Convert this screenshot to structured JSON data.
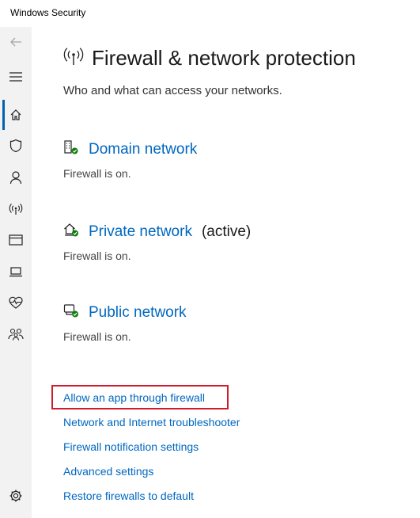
{
  "app": {
    "title": "Windows Security"
  },
  "sidebar": {
    "items": [
      {
        "name": "back",
        "icon": "back-arrow-icon"
      },
      {
        "name": "menu",
        "icon": "hamburger-menu-icon"
      },
      {
        "name": "home",
        "icon": "home-icon",
        "active": true
      },
      {
        "name": "virus-protection",
        "icon": "shield-icon"
      },
      {
        "name": "account-protection",
        "icon": "person-icon"
      },
      {
        "name": "firewall",
        "icon": "wifi-antenna-icon"
      },
      {
        "name": "app-browser-control",
        "icon": "browser-window-icon"
      },
      {
        "name": "device-security",
        "icon": "laptop-icon"
      },
      {
        "name": "device-performance",
        "icon": "heart-pulse-icon"
      },
      {
        "name": "family-options",
        "icon": "family-icon"
      },
      {
        "name": "settings",
        "icon": "gear-icon"
      }
    ],
    "accent": "#0063b1"
  },
  "page": {
    "title": "Firewall & network protection",
    "subtitle": "Who and what can access your networks.",
    "icon": "wifi-antenna-icon"
  },
  "networks": [
    {
      "label": "Domain network",
      "status": "Firewall is on.",
      "active_label": "",
      "icon": "domain-network-icon"
    },
    {
      "label": "Private network",
      "status": "Firewall is on.",
      "active_label": "(active)",
      "icon": "private-network-icon"
    },
    {
      "label": "Public network",
      "status": "Firewall is on.",
      "active_label": "",
      "icon": "public-network-icon"
    }
  ],
  "links": [
    "Allow an app through firewall",
    "Network and Internet troubleshooter",
    "Firewall notification settings",
    "Advanced settings",
    "Restore firewalls to default"
  ],
  "colors": {
    "link": "#0067c0",
    "highlight": "#d01c2a",
    "status_ok": "#107c10"
  }
}
